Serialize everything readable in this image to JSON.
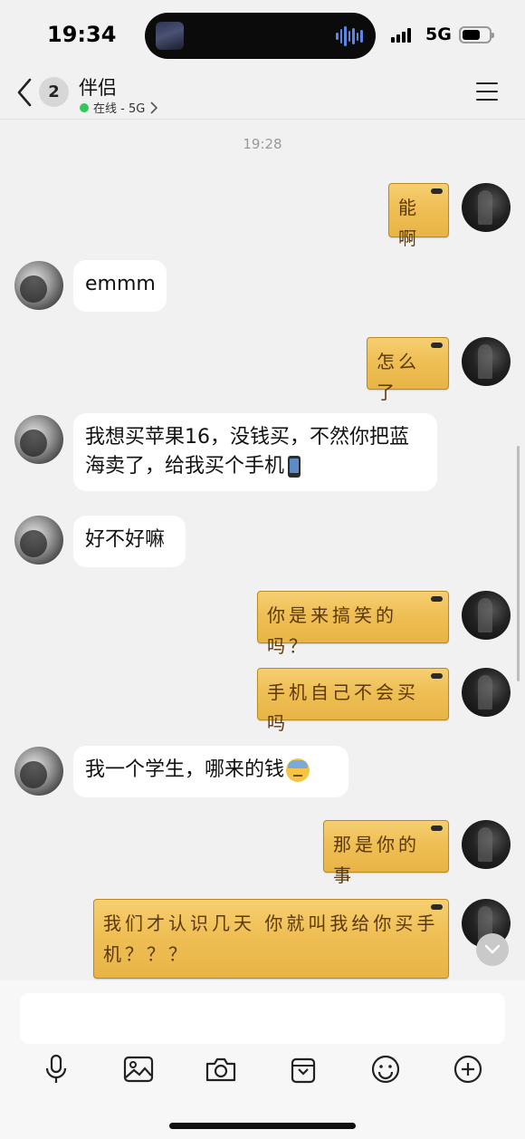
{
  "status_bar": {
    "time": "19:34",
    "network": "5G",
    "icons": [
      "signal-icon",
      "battery-icon"
    ]
  },
  "header": {
    "back_icon": "chevron-left-icon",
    "unread_count": "2",
    "contact_name": "伴侣",
    "status": "在线 - 5G",
    "status_color": "#34c759",
    "menu_icon": "hamburger-menu-icon"
  },
  "chat": {
    "timestamp": "19:28",
    "messages": [
      {
        "side": "out",
        "text": "能啊"
      },
      {
        "side": "in",
        "text": "emmm"
      },
      {
        "side": "out",
        "text": "怎么了"
      },
      {
        "side": "in",
        "text": "我想买苹果16，没钱买，不然你把蓝海卖了，给我买个手机",
        "emoji": "mobile-phone-emoji"
      },
      {
        "side": "in",
        "text": "好不好嘛"
      },
      {
        "side": "out",
        "text": "你是来搞笑的吗？"
      },
      {
        "side": "out",
        "text": "手机自己不会买吗"
      },
      {
        "side": "in",
        "text": "我一个学生，哪来的钱",
        "emoji": "sweat-emoji"
      },
      {
        "side": "out",
        "text": "那是你的事"
      },
      {
        "side": "out",
        "text": "我们才认识几天 你就叫我给你买手机？？？"
      }
    ],
    "bubble_out_color": "#efbf55",
    "bubble_in_color": "#ffffff"
  },
  "composer": {
    "input_value": "",
    "tools": [
      "microphone-icon",
      "image-icon",
      "camera-icon",
      "gift-box-icon",
      "emoji-smile-icon",
      "plus-circle-icon"
    ]
  }
}
